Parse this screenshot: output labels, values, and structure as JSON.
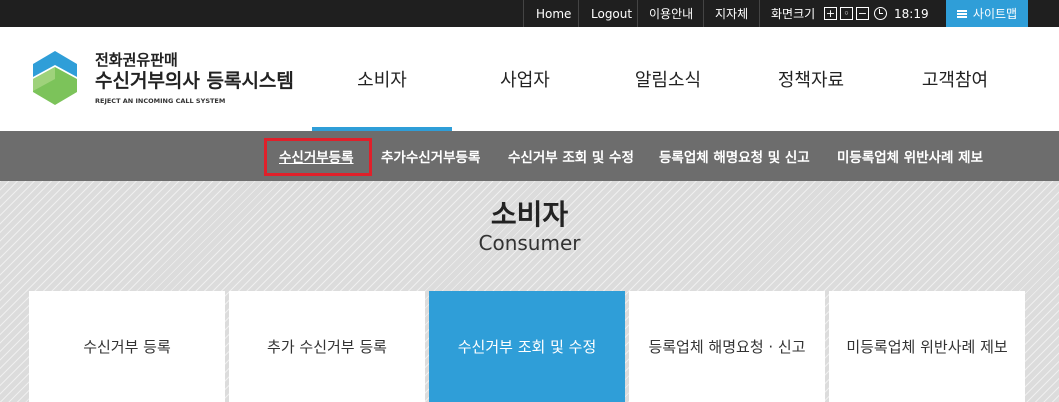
{
  "topbar": {
    "home": "Home",
    "logout": "Logout",
    "guide": "이용안내",
    "font": "지자체",
    "zoom_label": "화면크기",
    "zoom_in": "+",
    "zoom_reset": "◦",
    "zoom_out": "−",
    "time": "18:19",
    "sitemap": "사이트맵"
  },
  "logo": {
    "line1": "전화권유판매",
    "line2": "수신거부의사 등록시스템",
    "line3": "REJECT AN INCOMING CALL SYSTEM"
  },
  "gnb": [
    "소비자",
    "사업자",
    "알림소식",
    "정책자료",
    "고객참여"
  ],
  "subnav": [
    "수신거부등록",
    "추가수신거부등록",
    "수신거부 조회 및 수정",
    "등록업체 해명요청 및 신고",
    "미등록업체 위반사례 제보"
  ],
  "page": {
    "title": "소비자",
    "subtitle": "Consumer"
  },
  "tabs": [
    "수신거부 등록",
    "추가 수신거부 등록",
    "수신거부 조회 및 수정",
    "등록업체 해명요청 · 신고",
    "미등록업체 위반사례 제보"
  ],
  "colors": {
    "accent": "#2f9ed8",
    "topbar": "#1f1f1f",
    "subnav": "#6d6d6d",
    "highlight": "#e0202a"
  }
}
